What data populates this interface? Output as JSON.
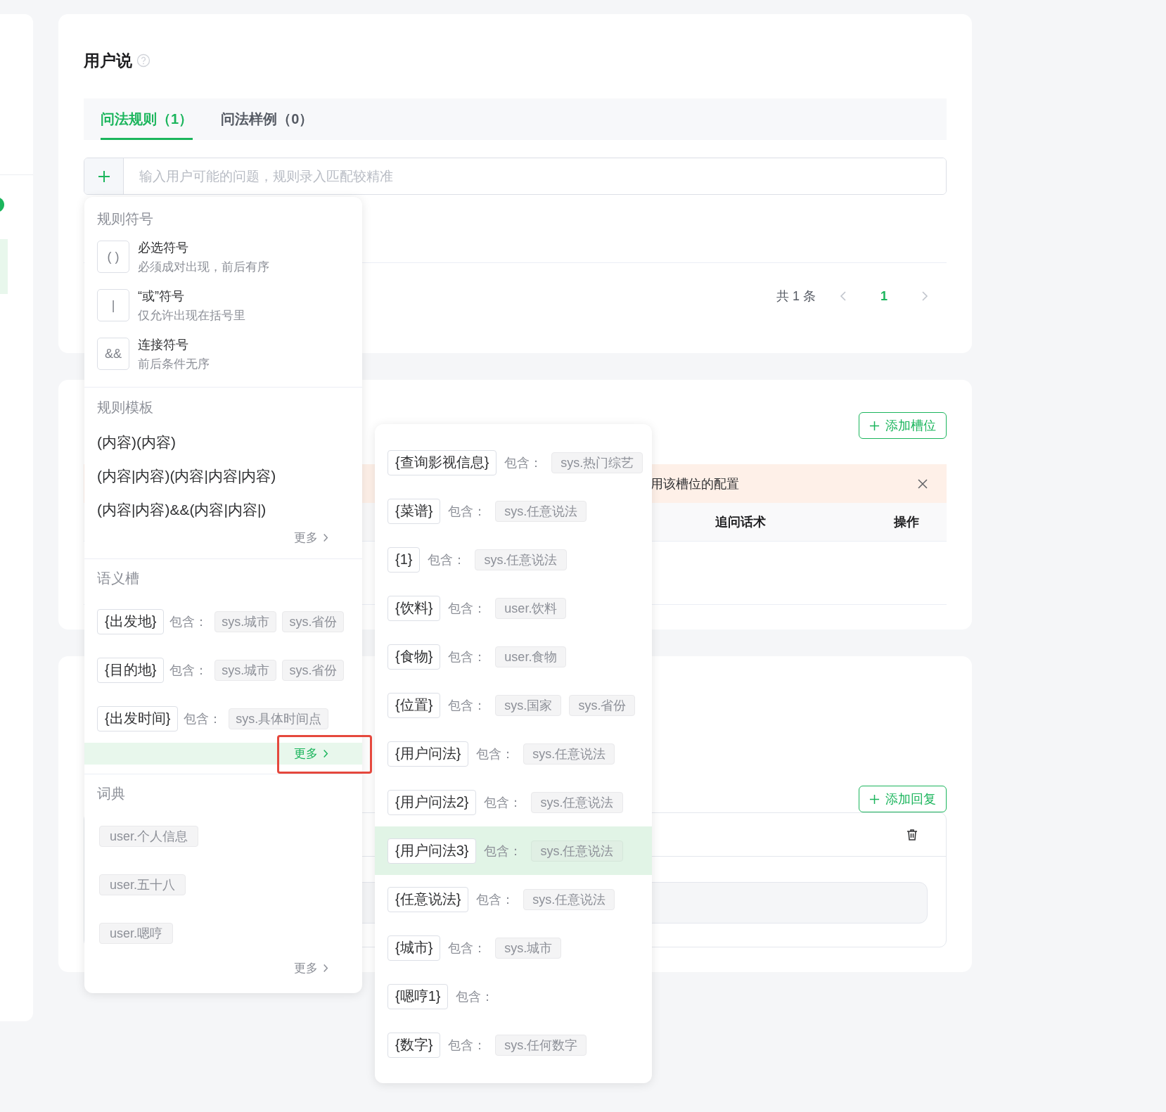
{
  "section_title": "用户说",
  "tabs": [
    {
      "label": "问法规则（1）",
      "selected": true
    },
    {
      "label": "问法样例（0）",
      "selected": false
    }
  ],
  "rule_input": {
    "placeholder": "输入用户可能的问题，规则录入匹配较精准"
  },
  "pagination": {
    "total": "共 1 条",
    "pages": [
      {
        "label": "1",
        "selected": true
      }
    ]
  },
  "slot_section": {
    "add_button": "添加槽位",
    "alert": "用该槽位的配置",
    "columns": [
      "追问话术",
      "操作"
    ]
  },
  "reply_section": {
    "add_button": "添加回复"
  },
  "insert_menu": {
    "symbols": {
      "title": "规则符号",
      "items": [
        {
          "symbol": "( )",
          "name": "必选符号",
          "hint": "必须成对出现，前后有序"
        },
        {
          "symbol": "|",
          "name": "“或”符号",
          "hint": "仅允许出现在括号里"
        },
        {
          "symbol": "&&",
          "name": "连接符号",
          "hint": "前后条件无序"
        }
      ]
    },
    "templates": {
      "title": "规则模板",
      "items": [
        "(内容)(内容)",
        "(内容|内容)(内容|内容|内容)",
        "(内容|内容)&&(内容|内容|)"
      ],
      "more": {
        "label": "更多",
        "selected": false
      }
    },
    "slots": {
      "title": "语义槽",
      "items": [
        {
          "name": "{出发地}",
          "label": "包含：",
          "values": [
            "sys.城市",
            "sys.省份"
          ]
        },
        {
          "name": "{目的地}",
          "label": "包含：",
          "values": [
            "sys.城市",
            "sys.省份"
          ]
        },
        {
          "name": "{出发时间}",
          "label": "包含：",
          "values": [
            "sys.具体时间点"
          ]
        }
      ],
      "more": {
        "label": "更多",
        "selected": true
      }
    },
    "dictionary": {
      "title": "词典",
      "items": [
        "user.个人信息",
        "user.五十八",
        "user.嗯哼"
      ],
      "more": {
        "label": "更多",
        "selected": false
      }
    }
  },
  "slot_menu": {
    "items": [
      {
        "name": "{查询影视信息}",
        "label": "包含：",
        "values": [
          "sys.热门综艺"
        ],
        "selected": false
      },
      {
        "name": "{菜谱}",
        "label": "包含：",
        "values": [
          "sys.任意说法"
        ],
        "selected": false
      },
      {
        "name": "{1}",
        "label": "包含：",
        "values": [
          "sys.任意说法"
        ],
        "selected": false
      },
      {
        "name": "{饮料}",
        "label": "包含：",
        "values": [
          "user.饮料"
        ],
        "selected": false
      },
      {
        "name": "{食物}",
        "label": "包含：",
        "values": [
          "user.食物"
        ],
        "selected": false
      },
      {
        "name": "{位置}",
        "label": "包含：",
        "values": [
          "sys.国家",
          "sys.省份"
        ],
        "selected": false
      },
      {
        "name": "{用户问法}",
        "label": "包含：",
        "values": [
          "sys.任意说法"
        ],
        "selected": false
      },
      {
        "name": "{用户问法2}",
        "label": "包含：",
        "values": [
          "sys.任意说法"
        ],
        "selected": false
      },
      {
        "name": "{用户问法3}",
        "label": "包含：",
        "values": [
          "sys.任意说法"
        ],
        "selected": true
      },
      {
        "name": "{任意说法}",
        "label": "包含：",
        "values": [
          "sys.任意说法"
        ],
        "selected": false
      },
      {
        "name": "{城市}",
        "label": "包含：",
        "values": [
          "sys.城市"
        ],
        "selected": false
      },
      {
        "name": "{嗯哼1}",
        "label": "包含：",
        "selected": false
      },
      {
        "name": "{数字}",
        "label": "包含：",
        "values": [
          "sys.任何数字"
        ],
        "selected": false
      }
    ]
  }
}
